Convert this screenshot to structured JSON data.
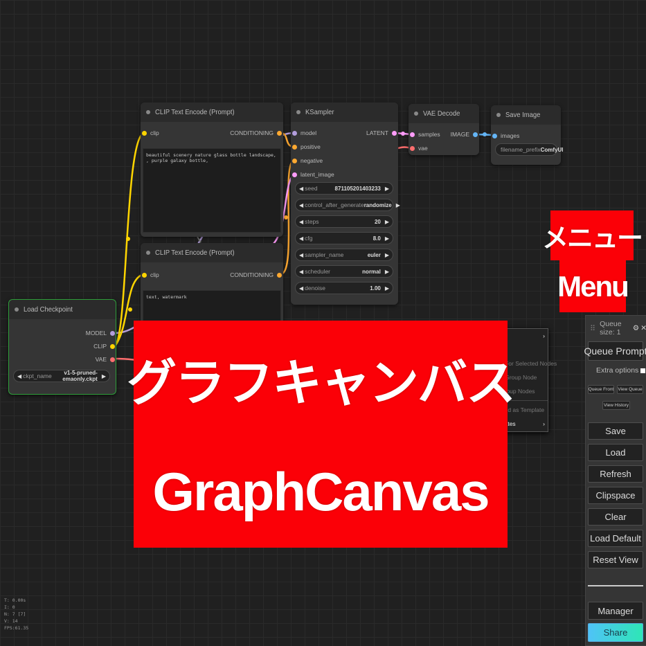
{
  "nodes": {
    "clip_text_encode_1": {
      "title": "CLIP Text Encode (Prompt)",
      "input_label": "clip",
      "output_label": "CONDITIONING",
      "text": "beautiful scenery nature glass bottle landscape, , purple galaxy bottle,"
    },
    "clip_text_encode_2": {
      "title": "CLIP Text Encode (Prompt)",
      "input_label": "clip",
      "output_label": "CONDITIONING",
      "text": "text, watermark"
    },
    "ksampler": {
      "title": "KSampler",
      "inputs": [
        "model",
        "positive",
        "negative",
        "latent_image"
      ],
      "output_label": "LATENT",
      "widgets": [
        {
          "label": "seed",
          "value": "871105201403233"
        },
        {
          "label": "control_after_generate",
          "value": "randomize"
        },
        {
          "label": "steps",
          "value": "20"
        },
        {
          "label": "cfg",
          "value": "8.0"
        },
        {
          "label": "sampler_name",
          "value": "euler"
        },
        {
          "label": "scheduler",
          "value": "normal"
        },
        {
          "label": "denoise",
          "value": "1.00"
        }
      ]
    },
    "vae_decode": {
      "title": "VAE Decode",
      "inputs": [
        "samples",
        "vae"
      ],
      "output_label": "IMAGE"
    },
    "save_image": {
      "title": "Save Image",
      "input_label": "images",
      "widget_label": "filename_prefix",
      "widget_value": "ComfyUI"
    },
    "load_checkpoint": {
      "title": "Load Checkpoint",
      "outputs": [
        "MODEL",
        "CLIP",
        "VAE"
      ],
      "widget_label": "ckpt_name",
      "widget_value": "v1-5-pruned-emaonly.ckpt"
    }
  },
  "context_menu": {
    "items": [
      {
        "label": "e",
        "has_arrow": true
      },
      {
        "label": "p",
        "has_arrow": false
      },
      {
        "label": "p For Selected Nodes",
        "has_arrow": false
      },
      {
        "label": "p Group Node",
        "has_arrow": false
      },
      {
        "label": "Group Nodes",
        "has_arrow": false
      },
      {
        "label": "cted as Template",
        "has_arrow": false
      },
      {
        "label": "plates",
        "has_arrow": true
      }
    ]
  },
  "annotations": {
    "menu_jp": "メニュー",
    "menu_en": "Menu",
    "canvas_jp": "グラフキャンバス",
    "canvas_en": "GraphCanvas"
  },
  "menu_panel": {
    "queue_size_label": "Queue size: 1",
    "queue_prompt": "Queue Prompt",
    "extra_options": "Extra options",
    "queue_front": "Queue Front",
    "view_queue": "View Queue",
    "view_history": "View History",
    "buttons": [
      "Save",
      "Load",
      "Refresh",
      "Clipspace",
      "Clear",
      "Load Default",
      "Reset View"
    ],
    "manager": "Manager",
    "share": "Share"
  },
  "stats": {
    "t": "T: 0.00s",
    "i": "I: 0",
    "n": "N: 7 [7]",
    "v": "V: 14",
    "fps": "FPS:61.35"
  },
  "colors": {
    "banner_red": "#fb0007",
    "model_link": "#b39ddb",
    "clip_link": "#ffd500",
    "vae_link": "#ff6e6e",
    "latent_link": "#ff9cf9",
    "image_link": "#64b5f6",
    "conditioning_link": "#ffa931",
    "share_gradient_start": "#4fc3f7",
    "share_gradient_end": "#2ee6b6",
    "checkpoint_border": "#2e9e3a"
  }
}
